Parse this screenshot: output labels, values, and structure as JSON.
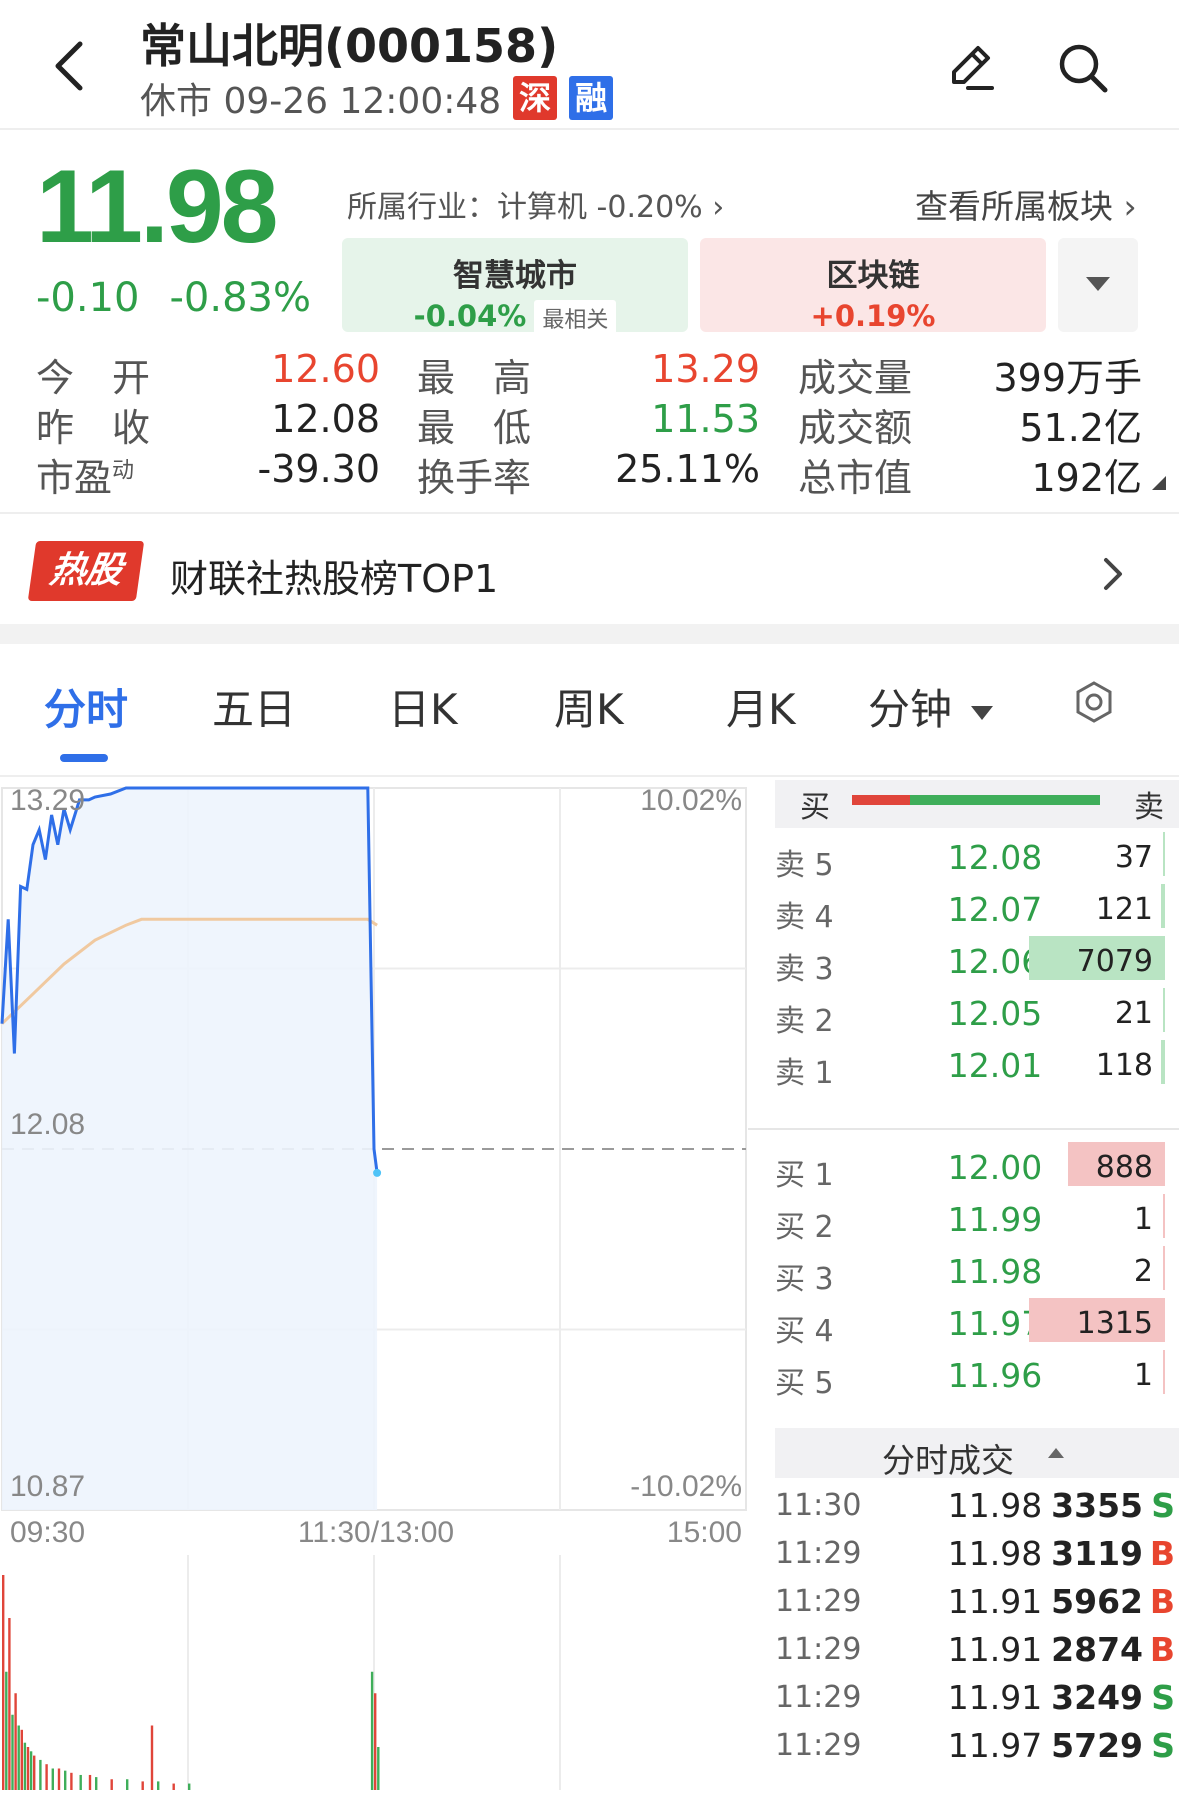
{
  "header": {
    "title": "常山北明(000158)",
    "status": "休市 09-26 12:00:48",
    "badge_shen": "深",
    "badge_rong": "融",
    "colors": {
      "shen": "#e0392c",
      "rong": "#2f6fe8"
    }
  },
  "quote": {
    "price": "11.98",
    "change": "-0.10",
    "change_pct": "-0.83%",
    "industry": "所属行业：计算机 -0.20%",
    "view_sector": "查看所属板块",
    "colors": {
      "up": "#e8452f",
      "down": "#2e9e48"
    }
  },
  "sectors": [
    {
      "name": "智慧城市",
      "value": "-0.04%",
      "tag": "最相关"
    },
    {
      "name": "区块链",
      "value": "+0.19%"
    }
  ],
  "stats": {
    "open_label": "今　开",
    "open": "12.60",
    "high_label": "最　高",
    "high": "13.29",
    "volume_label": "成交量",
    "volume": "399万手",
    "prev_label": "昨　收",
    "prev": "12.08",
    "low_label": "最　低",
    "low": "11.53",
    "amount_label": "成交额",
    "amount": "51.2亿",
    "pe_label": "市盈",
    "pe_sup": "动",
    "pe": "-39.30",
    "turnover_label": "换手率",
    "turnover": "25.11%",
    "mktcap_label": "总市值",
    "mktcap": "192亿"
  },
  "hot": {
    "badge": "热股",
    "text": "财联社热股榜TOP1"
  },
  "tabs": [
    "分时",
    "五日",
    "日K",
    "周K",
    "月K",
    "分钟"
  ],
  "chart_data": {
    "type": "line",
    "y_left_labels": [
      "13.29",
      "12.08",
      "10.87"
    ],
    "y_right_labels": [
      "10.02%",
      "-10.02%"
    ],
    "x_labels": [
      "09:30",
      "11:30/13:00",
      "15:00"
    ],
    "ylim": [
      10.87,
      13.29
    ],
    "prev_close": 12.08,
    "series": [
      {
        "color": "#2f6fe8",
        "x": [
          0,
          2,
          4,
          6,
          8,
          10,
          12,
          14,
          16,
          18,
          20,
          22,
          25,
          28,
          30,
          35,
          40,
          45,
          50,
          55,
          60,
          70,
          80,
          90,
          100,
          110,
          118,
          120,
          121
        ],
        "values": [
          12.5,
          12.85,
          12.4,
          12.96,
          12.95,
          13.1,
          13.15,
          13.05,
          13.2,
          13.1,
          13.22,
          13.15,
          13.25,
          13.25,
          13.26,
          13.27,
          13.29,
          13.29,
          13.29,
          13.29,
          13.29,
          13.29,
          13.29,
          13.29,
          13.29,
          13.29,
          13.29,
          12.08,
          12.0
        ]
      },
      {
        "color": "#f0c9a0",
        "x": [
          0,
          10,
          20,
          30,
          40,
          45,
          60,
          80,
          100,
          118,
          121
        ],
        "values": [
          12.5,
          12.6,
          12.7,
          12.78,
          12.83,
          12.85,
          12.85,
          12.85,
          12.85,
          12.85,
          12.83
        ]
      }
    ],
    "volume": {
      "x": [
        0,
        1,
        2,
        3,
        4,
        5,
        6,
        7,
        8,
        9,
        10,
        12,
        14,
        16,
        18,
        20,
        22,
        25,
        28,
        30,
        35,
        40,
        45,
        48,
        50,
        55,
        60,
        119,
        120,
        121
      ],
      "values": [
        100,
        55,
        80,
        35,
        45,
        30,
        28,
        22,
        20,
        18,
        16,
        14,
        12,
        10,
        10,
        9,
        8,
        7,
        7,
        6,
        5,
        5,
        4,
        30,
        4,
        3,
        3,
        55,
        45,
        20
      ],
      "colors": [
        "r",
        "g",
        "r",
        "g",
        "r",
        "g",
        "r",
        "g",
        "r",
        "g",
        "r",
        "g",
        "r",
        "g",
        "r",
        "g",
        "r",
        "g",
        "r",
        "g",
        "r",
        "g",
        "r",
        "r",
        "g",
        "r",
        "g",
        "g",
        "r",
        "g"
      ]
    }
  },
  "orderbook": {
    "buy_label": "买",
    "sell_label": "卖",
    "sell": [
      {
        "level": "卖 5",
        "price": "12.08",
        "volume": "37",
        "vol": 37
      },
      {
        "level": "卖 4",
        "price": "12.07",
        "volume": "121",
        "vol": 121
      },
      {
        "level": "卖 3",
        "price": "12.06",
        "volume": "7079",
        "vol": 7079
      },
      {
        "level": "卖 2",
        "price": "12.05",
        "volume": "21",
        "vol": 21
      },
      {
        "level": "卖 1",
        "price": "12.01",
        "volume": "118",
        "vol": 118
      }
    ],
    "buy": [
      {
        "level": "买 1",
        "price": "12.00",
        "volume": "888",
        "vol": 888
      },
      {
        "level": "买 2",
        "price": "11.99",
        "volume": "1",
        "vol": 1
      },
      {
        "level": "买 3",
        "price": "11.98",
        "volume": "2",
        "vol": 2
      },
      {
        "level": "买 4",
        "price": "11.97",
        "volume": "1315",
        "vol": 1315
      },
      {
        "level": "买 5",
        "price": "11.96",
        "volume": "1",
        "vol": 1
      }
    ]
  },
  "ticks": {
    "title": "分时成交",
    "rows": [
      {
        "time": "11:30",
        "price": "11.98",
        "volume": "3355",
        "dir": "S"
      },
      {
        "time": "11:29",
        "price": "11.98",
        "volume": "3119",
        "dir": "B"
      },
      {
        "time": "11:29",
        "price": "11.91",
        "volume": "5962",
        "dir": "B"
      },
      {
        "time": "11:29",
        "price": "11.91",
        "volume": "2874",
        "dir": "B"
      },
      {
        "time": "11:29",
        "price": "11.91",
        "volume": "3249",
        "dir": "S"
      },
      {
        "time": "11:29",
        "price": "11.97",
        "volume": "5729",
        "dir": "S"
      }
    ]
  }
}
